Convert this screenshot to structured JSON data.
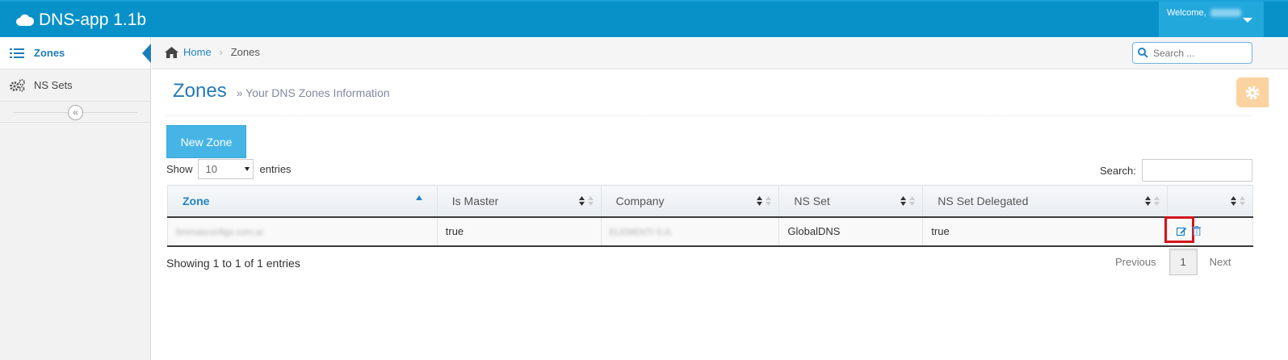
{
  "app": {
    "title": "DNS-app 1.1b",
    "welcome": "Welcome,",
    "user_name": "Pruebas"
  },
  "sidebar": {
    "items": [
      {
        "label": "Zones",
        "icon": "list-icon",
        "active": true
      },
      {
        "label": "NS Sets",
        "icon": "cogs-icon",
        "active": false
      }
    ],
    "collapse_icon": "double-chevron-left-icon"
  },
  "breadcrumb": {
    "home": "Home",
    "current": "Zones"
  },
  "top_search": {
    "placeholder": "Search ..."
  },
  "page": {
    "title": "Zones",
    "subtitle": "» Your DNS Zones Information"
  },
  "toolbar": {
    "new_zone": "New Zone"
  },
  "table_controls": {
    "show": "Show",
    "page_size": "10",
    "entries": "entries",
    "search_label": "Search:"
  },
  "table": {
    "columns": [
      "Zone",
      "Is Master",
      "Company",
      "NS Set",
      "NS Set Delegated",
      ""
    ],
    "sorted_column": "Zone",
    "rows": [
      {
        "zone": "bmmasconfigo.com.ar",
        "is_master": "true",
        "company": "ELEMENTI S.A.",
        "ns_set": "GlobalDNS",
        "ns_set_delegated": "true"
      }
    ]
  },
  "footer": {
    "info": "Showing 1 to 1 of 1 entries",
    "previous": "Previous",
    "page": "1",
    "next": "Next"
  },
  "colors": {
    "topbar": "#0891c8",
    "accent": "#2283c3",
    "button": "#47b4e6",
    "highlight": "#d4141c",
    "settings": "#fbd3a0"
  }
}
